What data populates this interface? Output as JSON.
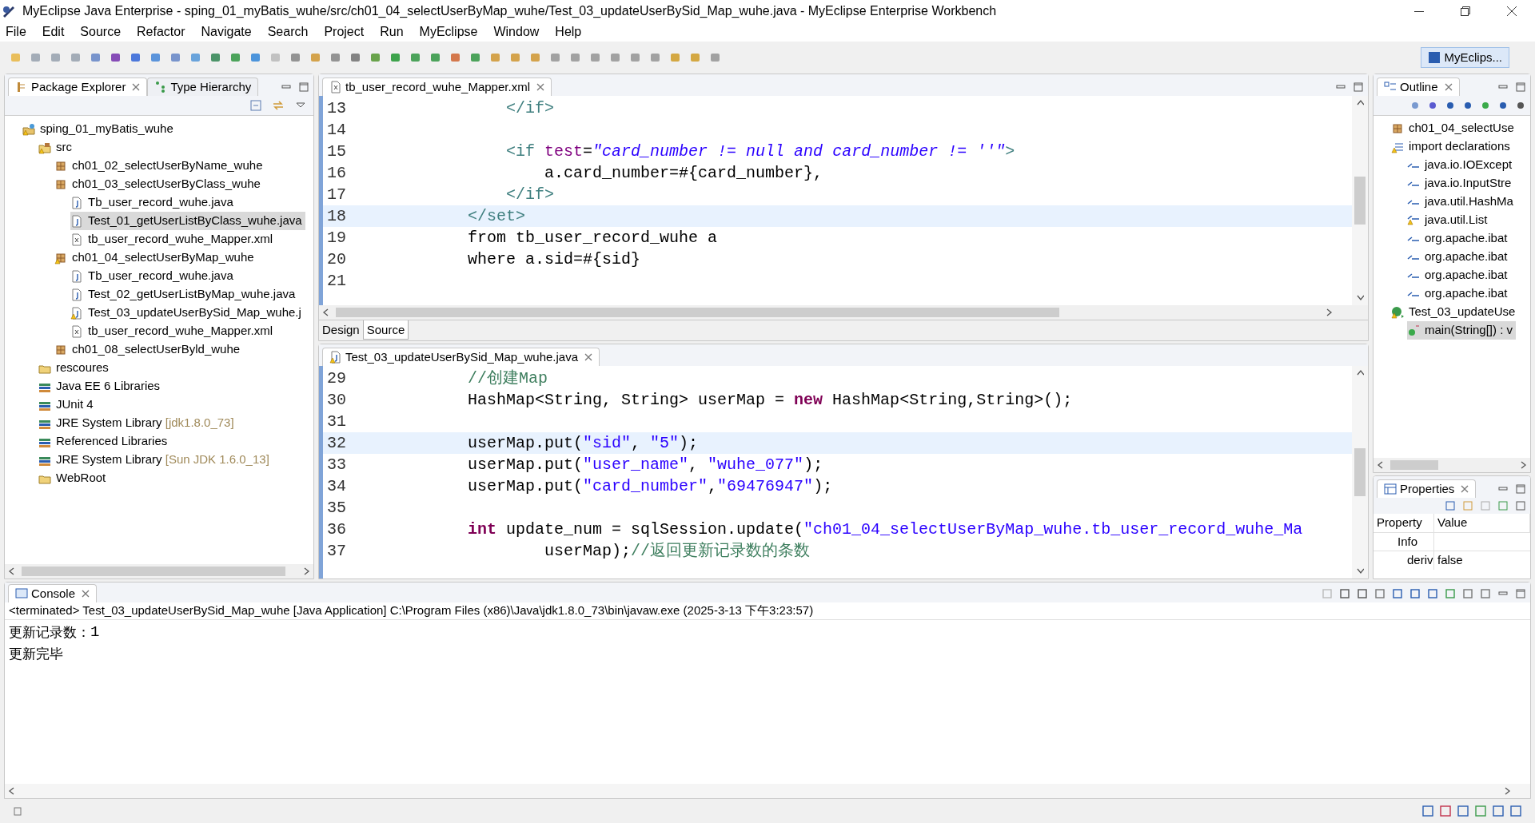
{
  "window": {
    "title": "MyEclipse Java Enterprise - sping_01_myBatis_wuhe/src/ch01_04_selectUserByMap_wuhe/Test_03_updateUserBySid_Map_wuhe.java - MyEclipse Enterprise Workbench"
  },
  "menu": [
    "File",
    "Edit",
    "Source",
    "Refactor",
    "Navigate",
    "Search",
    "Project",
    "Run",
    "MyEclipse",
    "Window",
    "Help"
  ],
  "perspective": {
    "label": "MyEclips...",
    "selected": true
  },
  "left_tabs": [
    {
      "label": "Package Explorer",
      "selected": true
    },
    {
      "label": "Type Hierarchy",
      "selected": false
    }
  ],
  "tree": [
    {
      "label": "sping_01_myBatis_wuhe",
      "kind": "project",
      "warning": true,
      "selected": false,
      "children": [
        {
          "label": "src",
          "kind": "srcfolder",
          "warning": true,
          "selected": false,
          "children": [
            {
              "label": "ch01_02_selectUserByName_wuhe",
              "kind": "package",
              "warning": false,
              "selected": false
            },
            {
              "label": "ch01_03_selectUserByClass_wuhe",
              "kind": "package",
              "warning": false,
              "selected": false,
              "children": [
                {
                  "label": "Tb_user_record_wuhe.java",
                  "kind": "java",
                  "warning": false,
                  "selected": false
                },
                {
                  "label": "Test_01_getUserListByClass_wuhe.java",
                  "kind": "java",
                  "warning": false,
                  "selected": true
                },
                {
                  "label": "tb_user_record_wuhe_Mapper.xml",
                  "kind": "xml",
                  "warning": false,
                  "selected": false
                }
              ]
            },
            {
              "label": "ch01_04_selectUserByMap_wuhe",
              "kind": "package",
              "warning": true,
              "selected": false,
              "children": [
                {
                  "label": "Tb_user_record_wuhe.java",
                  "kind": "java",
                  "warning": false,
                  "selected": false
                },
                {
                  "label": "Test_02_getUserListByMap_wuhe.java",
                  "kind": "java",
                  "warning": false,
                  "selected": false
                },
                {
                  "label": "Test_03_updateUserBySid_Map_wuhe.j",
                  "kind": "java",
                  "warning": true,
                  "selected": false
                },
                {
                  "label": "tb_user_record_wuhe_Mapper.xml",
                  "kind": "xml",
                  "warning": false,
                  "selected": false
                }
              ]
            },
            {
              "label": "ch01_08_selectUserByld_wuhe",
              "kind": "package",
              "warning": false,
              "selected": false
            }
          ]
        },
        {
          "label": "rescoures",
          "kind": "folder",
          "warning": false,
          "selected": false
        },
        {
          "label": "Java EE 6 Libraries",
          "kind": "library",
          "warning": false,
          "selected": false
        },
        {
          "label": "JUnit 4",
          "kind": "library",
          "warning": false,
          "selected": false
        },
        {
          "label": "JRE System Library",
          "detail": "[jdk1.8.0_73]",
          "kind": "library",
          "warning": false,
          "selected": false
        },
        {
          "label": "Referenced Libraries",
          "kind": "library",
          "warning": false,
          "selected": false
        },
        {
          "label": "JRE System Library",
          "detail": "[Sun JDK 1.6.0_13]",
          "kind": "library",
          "warning": false,
          "selected": false
        },
        {
          "label": "WebRoot",
          "kind": "folder",
          "warning": false,
          "selected": false
        }
      ]
    }
  ],
  "xml_editor": {
    "tab": "tb_user_record_wuhe_Mapper.xml",
    "lines": [
      {
        "n": "13",
        "current": false,
        "segs": [
          {
            "kind": "tag",
            "text": "            </if>"
          }
        ]
      },
      {
        "n": "14",
        "current": false
      },
      {
        "n": "15",
        "current": false,
        "segs": [
          {
            "kind": "tag",
            "text": "            <if"
          },
          {
            "kind": "attr",
            "text": " test"
          },
          {
            "kind": "plain",
            "text": "="
          },
          {
            "kind": "value",
            "text": "\"card_number != null and card_number != ''\""
          },
          {
            "kind": "tag",
            "text": ">"
          }
        ]
      },
      {
        "n": "16",
        "current": false,
        "segs": [
          {
            "kind": "plain",
            "text": "                a.card_number=#{card_number},"
          }
        ]
      },
      {
        "n": "17",
        "current": false,
        "segs": [
          {
            "kind": "tag",
            "text": "            </if>"
          }
        ]
      },
      {
        "n": "18",
        "current": true,
        "segs": [
          {
            "kind": "tag",
            "text": "        </set>"
          }
        ]
      },
      {
        "n": "19",
        "current": false,
        "segs": [
          {
            "kind": "plain",
            "text": "        from tb_user_record_wuhe a"
          }
        ]
      },
      {
        "n": "20",
        "current": false,
        "segs": [
          {
            "kind": "plain",
            "text": "        where a.sid=#{sid}"
          }
        ]
      },
      {
        "n": "21",
        "current": false
      }
    ],
    "bottom_tabs": [
      {
        "label": "Design",
        "selected": false
      },
      {
        "label": "Source",
        "selected": true
      }
    ]
  },
  "java_editor": {
    "tab": "Test_03_updateUserBySid_Map_wuhe.java",
    "lines": [
      {
        "n": "29",
        "current": false,
        "segs": [
          {
            "kind": "comment",
            "text": "        //创建Map"
          }
        ]
      },
      {
        "n": "30",
        "current": false,
        "segs": [
          {
            "kind": "plain",
            "text": "        HashMap<String, String> userMap = "
          },
          {
            "kind": "keyword",
            "text": "new"
          },
          {
            "kind": "plain",
            "text": " HashMap<String,String>();"
          }
        ]
      },
      {
        "n": "31",
        "current": false
      },
      {
        "n": "32",
        "current": true,
        "segs": [
          {
            "kind": "plain",
            "text": "        userMap.put("
          },
          {
            "kind": "string",
            "text": "\"sid\""
          },
          {
            "kind": "plain",
            "text": ", "
          },
          {
            "kind": "string",
            "text": "\"5\""
          },
          {
            "kind": "plain",
            "text": ");"
          }
        ]
      },
      {
        "n": "33",
        "current": false,
        "segs": [
          {
            "kind": "plain",
            "text": "        userMap.put("
          },
          {
            "kind": "string",
            "text": "\"user_name\""
          },
          {
            "kind": "plain",
            "text": ", "
          },
          {
            "kind": "string",
            "text": "\"wuhe_077\""
          },
          {
            "kind": "plain",
            "text": ");"
          }
        ]
      },
      {
        "n": "34",
        "current": false,
        "segs": [
          {
            "kind": "plain",
            "text": "        userMap.put("
          },
          {
            "kind": "string",
            "text": "\"card_number\""
          },
          {
            "kind": "plain",
            "text": ","
          },
          {
            "kind": "string",
            "text": "\"69476947\""
          },
          {
            "kind": "plain",
            "text": ");"
          }
        ]
      },
      {
        "n": "35",
        "current": false
      },
      {
        "n": "36",
        "current": false,
        "segs": [
          {
            "kind": "keyword",
            "text": "        int"
          },
          {
            "kind": "plain",
            "text": " update_num = sqlSession.update("
          },
          {
            "kind": "string",
            "text": "\"ch01_04_selectUserByMap_wuhe.tb_user_record_wuhe_Ma"
          }
        ]
      },
      {
        "n": "37",
        "current": false,
        "segs": [
          {
            "kind": "plain",
            "text": "                userMap);"
          },
          {
            "kind": "comment",
            "text": "//返回更新记录数的条数"
          }
        ]
      }
    ]
  },
  "outline": {
    "title": "Outline",
    "items": [
      {
        "label": "ch01_04_selectUse",
        "kind": "package",
        "warning": false,
        "selected": false
      },
      {
        "label": "import declarations",
        "kind": "imports",
        "warning": true,
        "selected": false,
        "children": [
          {
            "label": "java.io.IOExcept",
            "kind": "import",
            "warning": false,
            "selected": false
          },
          {
            "label": "java.io.InputStre",
            "kind": "import",
            "warning": false,
            "selected": false
          },
          {
            "label": "java.util.HashMa",
            "kind": "import",
            "warning": false,
            "selected": false
          },
          {
            "label": "java.util.List",
            "kind": "import",
            "warning": true,
            "selected": false
          },
          {
            "label": "org.apache.ibat",
            "kind": "import",
            "warning": false,
            "selected": false
          },
          {
            "label": "org.apache.ibat",
            "kind": "import",
            "warning": false,
            "selected": false
          },
          {
            "label": "org.apache.ibat",
            "kind": "import",
            "warning": false,
            "selected": false
          },
          {
            "label": "org.apache.ibat",
            "kind": "import",
            "warning": false,
            "selected": false
          }
        ]
      },
      {
        "label": "Test_03_updateUse",
        "kind": "class",
        "warning": true,
        "selected": false,
        "children": [
          {
            "label": "main(String[]) : v",
            "kind": "method",
            "warning": false,
            "selected": true
          }
        ]
      }
    ]
  },
  "properties": {
    "title": "Properties",
    "columns": [
      "Property",
      "Value"
    ],
    "category": "Info",
    "rows": [
      {
        "property": "deriv",
        "value": "false"
      }
    ]
  },
  "console": {
    "title": "Console",
    "header": "<terminated> Test_03_updateUserBySid_Map_wuhe [Java Application] C:\\Program Files (x86)\\Java\\jdk1.8.0_73\\bin\\javaw.exe (2025-3-13 下午3:23:57)",
    "output": [
      {
        "label": "更新记录数：",
        "value": "1"
      },
      {
        "label": "更新完毕"
      }
    ]
  }
}
